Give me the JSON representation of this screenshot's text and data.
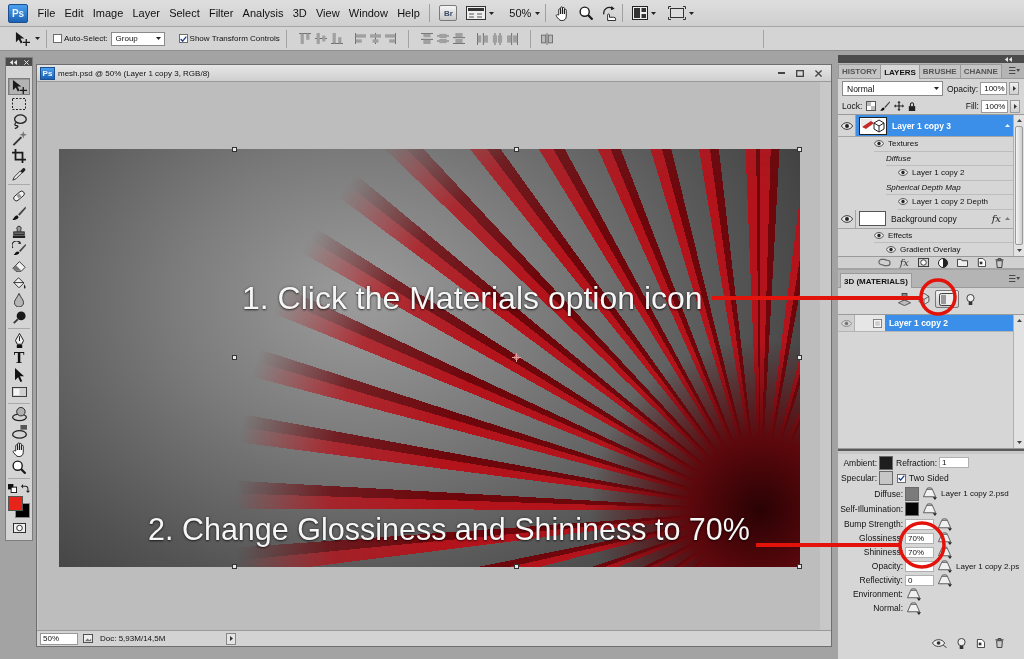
{
  "menu_bar": {
    "logo": "Ps",
    "items": [
      "File",
      "Edit",
      "Image",
      "Layer",
      "Select",
      "Filter",
      "Analysis",
      "3D",
      "View",
      "Window",
      "Help"
    ],
    "bridge_button": "Br",
    "zoom": "50%"
  },
  "options_bar": {
    "auto_select": {
      "label": "Auto-Select:",
      "checked": false
    },
    "auto_select_target": "Group",
    "show_transform_controls": {
      "label": "Show Transform Controls",
      "checked": true
    }
  },
  "toolbox": {
    "groups": [
      {
        "tools": [
          {
            "kind": "move",
            "selected": true
          },
          {
            "kind": "marquee",
            "selected": false
          },
          {
            "kind": "lasso",
            "selected": false
          },
          {
            "kind": "wand",
            "selected": false
          },
          {
            "kind": "crop",
            "selected": false
          },
          {
            "kind": "eyedropper",
            "selected": false
          }
        ]
      },
      {
        "tools": [
          {
            "kind": "healing",
            "selected": false
          },
          {
            "kind": "brush",
            "selected": false
          },
          {
            "kind": "stamp",
            "selected": false
          },
          {
            "kind": "history",
            "selected": false
          },
          {
            "kind": "eraser",
            "selected": false
          },
          {
            "kind": "bucket",
            "selected": false
          },
          {
            "kind": "blur",
            "selected": false
          },
          {
            "kind": "dodge",
            "selected": false
          }
        ]
      },
      {
        "tools": [
          {
            "kind": "pen",
            "selected": false
          },
          {
            "kind": "type",
            "glyph": "T",
            "selected": false
          },
          {
            "kind": "path",
            "selected": false
          },
          {
            "kind": "shape",
            "selected": false
          }
        ]
      },
      {
        "tools": [
          {
            "kind": "rotate3d",
            "selected": false
          },
          {
            "kind": "orbit3d",
            "selected": false
          },
          {
            "kind": "hand",
            "selected": false
          },
          {
            "kind": "zoom",
            "selected": false
          }
        ]
      }
    ],
    "color_swatches": [
      {
        "kind": "foreground",
        "color": "#e8231a"
      },
      {
        "kind": "background",
        "color": "#000000"
      }
    ]
  },
  "document": {
    "icon": "Ps",
    "title": "mesh.psd @ 50% (Layer 1 copy 3, RGB/8)",
    "zoom": "50%",
    "doc_info": "Doc: 5,93M/14,5M"
  },
  "annotations": [
    {
      "text": "1. Click the Materials option icon"
    },
    {
      "text": "2. Change Glossiness and Shininess to 70%"
    }
  ],
  "layers_panel": {
    "tabs": [
      {
        "label": "HISTORY",
        "selected": false
      },
      {
        "label": "LAYERS",
        "selected": true
      },
      {
        "label": "BRUSHE",
        "selected": false
      },
      {
        "label": "CHANNE",
        "selected": false
      }
    ],
    "blend_mode": "Normal",
    "opacity_label": "Opacity:",
    "opacity": "100%",
    "lock_label": "Lock:",
    "fill_label": "Fill:",
    "fill": "100%",
    "layers": [
      {
        "name": "Layer 1 copy 3",
        "kind": "model",
        "visible": true,
        "selected": true,
        "expanded": true,
        "children": [
          {
            "name": "Textures",
            "kind": "entry",
            "visible": true,
            "children": [
              {
                "name": "Diffuse",
                "kind": "map",
                "children": [
                  {
                    "name": "Layer 1 copy 2",
                    "kind": "entry",
                    "visible": true
                  }
                ]
              },
              {
                "name": "Spherical Depth Map",
                "kind": "map",
                "children": [
                  {
                    "name": "Layer 1 copy 2 Depth",
                    "kind": "entry",
                    "visible": true
                  }
                ]
              }
            ]
          }
        ]
      },
      {
        "name": "Background copy",
        "kind": "layer",
        "visible": true,
        "selected": false,
        "expanded": true,
        "fx_badge": "fx",
        "children": [
          {
            "name": "Effects",
            "kind": "entry",
            "visible": true,
            "children": [
              {
                "name": "Gradient Overlay",
                "kind": "entry",
                "visible": true
              }
            ]
          }
        ]
      }
    ],
    "effects_button": "fx"
  },
  "materials_panel": {
    "tabs": [
      {
        "label": "3D (MATERIALS)",
        "selected": true
      }
    ],
    "filters": [
      {
        "kind": "scene",
        "selected": false
      },
      {
        "kind": "mesh",
        "selected": false
      },
      {
        "kind": "materials",
        "selected": true
      },
      {
        "kind": "lights",
        "selected": false
      }
    ],
    "materials": [
      {
        "name": "Layer 1 copy 2",
        "visible": true,
        "selected": true
      }
    ],
    "properties": [
      {
        "kind": "swatch",
        "label": "Ambient:",
        "color": "#1e1e1e",
        "extra": {
          "kind": "field",
          "label": "Refraction:",
          "value": "1"
        }
      },
      {
        "kind": "swatch",
        "label": "Specular:",
        "color": "#c6c6c6",
        "extra": {
          "kind": "checkbox",
          "label": "Two Sided",
          "checked": true
        }
      },
      {
        "kind": "texture",
        "label": "Diffuse:",
        "color": "#7b7b7b",
        "file": "Layer 1 copy 2.psd"
      },
      {
        "kind": "texture",
        "label": "Self-Illumination:",
        "color": "#050505"
      },
      {
        "kind": "value",
        "label": "Bump Strength:"
      },
      {
        "kind": "value",
        "label": "Glossiness:",
        "value": "70%"
      },
      {
        "kind": "value",
        "label": "Shininess:",
        "value": "70%"
      },
      {
        "kind": "value",
        "label": "Opacity:",
        "file": "Layer 1 copy 2.ps"
      },
      {
        "kind": "value",
        "label": "Reflectivity:",
        "value": "0"
      },
      {
        "kind": "map",
        "label": "Environment:"
      },
      {
        "kind": "map",
        "label": "Normal:"
      }
    ]
  }
}
